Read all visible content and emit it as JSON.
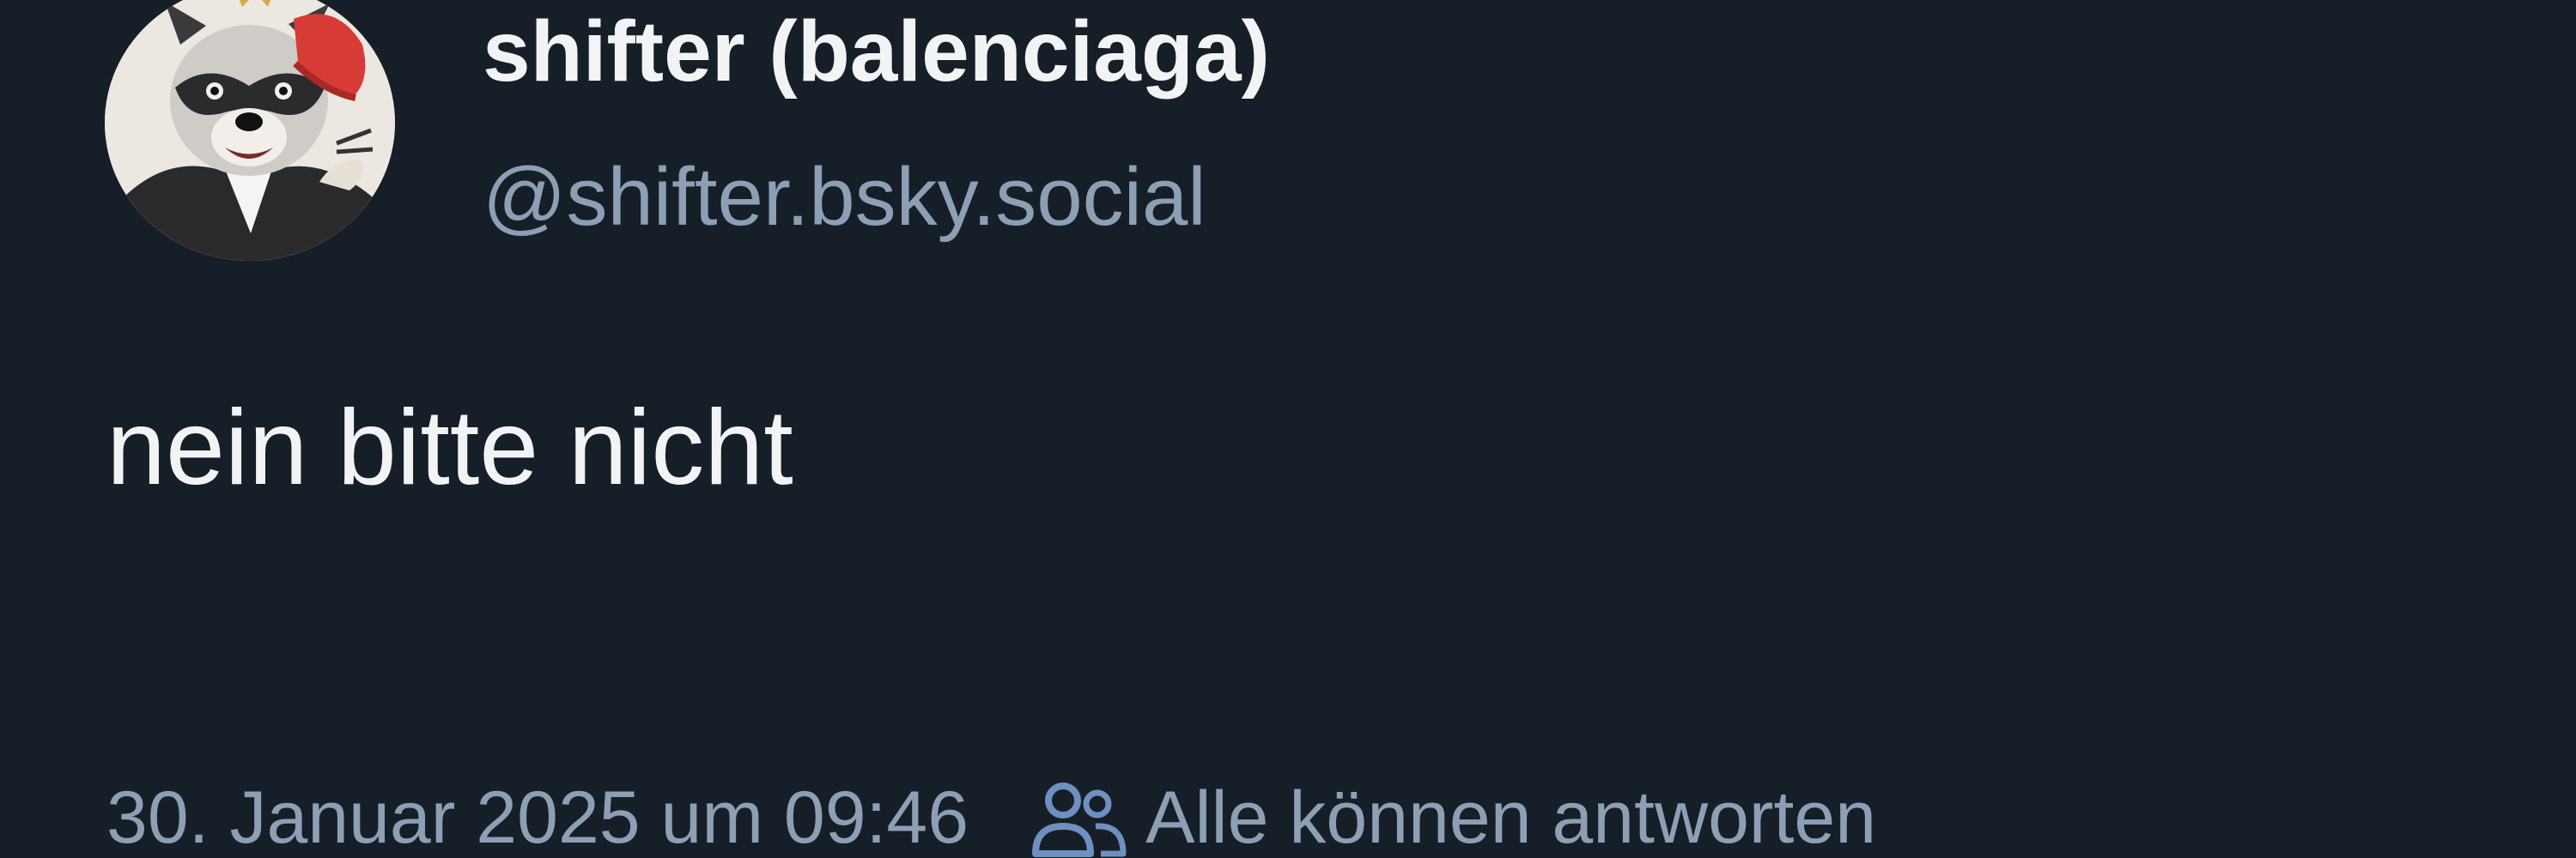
{
  "post": {
    "author": {
      "display_name": "shifter (balenciaga)",
      "handle": "@shifter.bsky.social",
      "avatar_icon": "raccoon-avatar"
    },
    "text": "nein bitte nicht",
    "timestamp": "30. Januar 2025 um 09:46",
    "reply_setting": {
      "icon": "people-icon",
      "label": "Alle können antworten"
    }
  },
  "colors": {
    "background": "#161e27",
    "primary_text": "#f1f3f5",
    "secondary_text": "#8c9fb5",
    "icon_accent": "#6f8fc0"
  }
}
